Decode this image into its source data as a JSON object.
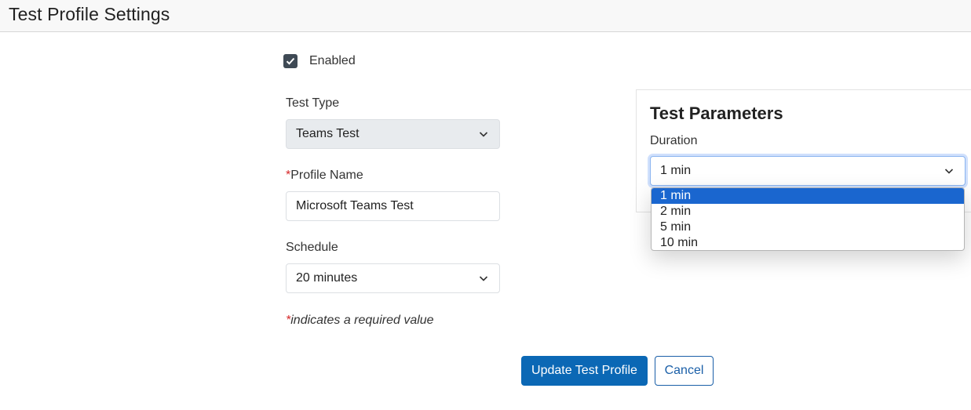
{
  "header": {
    "title": "Test Profile Settings"
  },
  "enabled": {
    "label": "Enabled",
    "checked": true
  },
  "test_type": {
    "label": "Test Type",
    "value": "Teams Test"
  },
  "profile_name": {
    "required_marker": "*",
    "label": "Profile Name",
    "value": "Microsoft Teams Test"
  },
  "schedule": {
    "label": "Schedule",
    "value": "20 minutes"
  },
  "required_note": {
    "marker": "*",
    "text": "indicates a required value"
  },
  "buttons": {
    "update": "Update Test Profile",
    "cancel": "Cancel"
  },
  "parameters": {
    "title": "Test Parameters",
    "duration_label": "Duration",
    "duration_value": "1 min",
    "options": [
      "1 min",
      "2 min",
      "5 min",
      "10 min"
    ],
    "selected_index": 0
  },
  "colors": {
    "primary": "#0b68b5",
    "checkbox": "#3f4a55",
    "highlight": "#1a66cf",
    "required": "#d62728"
  },
  "icons": {
    "chevron": "chevron-down-icon",
    "check": "check-icon"
  }
}
